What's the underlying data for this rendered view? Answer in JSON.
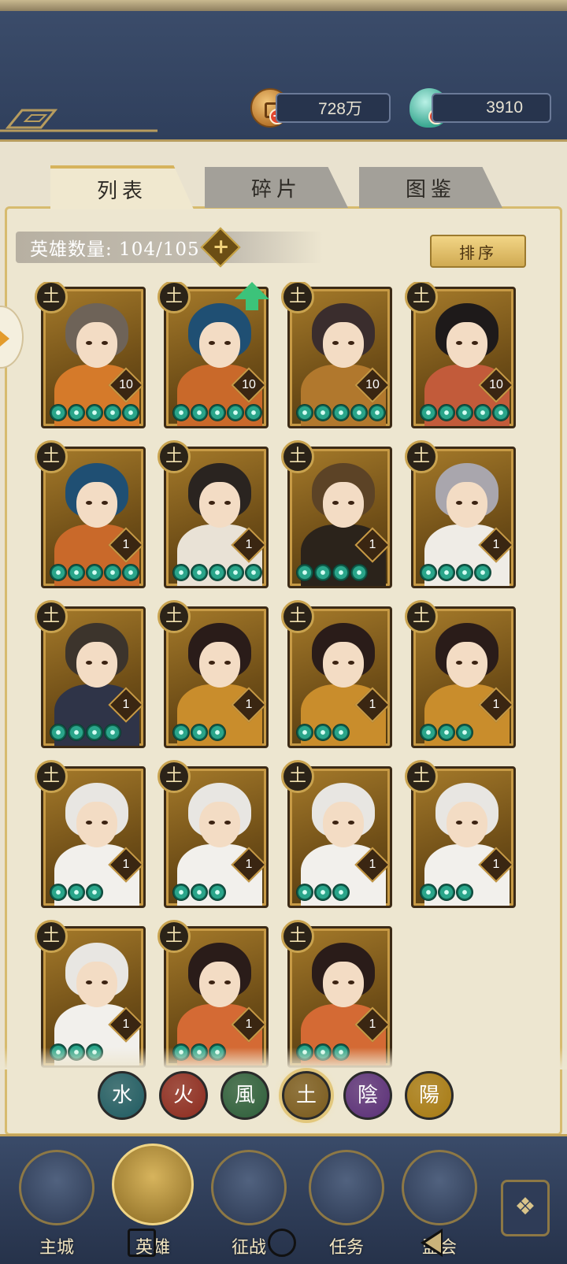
{
  "currency": {
    "coins": "728万",
    "jade": "3910"
  },
  "tabs": [
    "列表",
    "碎片",
    "图鉴"
  ],
  "hero_count": "英雄数量: 104/105",
  "sort_label": "排序",
  "element_symbol": "土",
  "heroes": [
    {
      "level": "10",
      "stars": 5,
      "hair": "#6e6358",
      "body": "#d57a2a",
      "upgrade": false
    },
    {
      "level": "10",
      "stars": 5,
      "hair": "#1f4f73",
      "body": "#c9692a",
      "upgrade": true
    },
    {
      "level": "10",
      "stars": 5,
      "hair": "#3a2d2d",
      "body": "#b1782d",
      "upgrade": false
    },
    {
      "level": "10",
      "stars": 5,
      "hair": "#1e1a1a",
      "body": "#c25b3a",
      "upgrade": false
    },
    {
      "level": "1",
      "stars": 5,
      "hair": "#1f4f73",
      "body": "#c9692a",
      "upgrade": false
    },
    {
      "level": "1",
      "stars": 5,
      "hair": "#2a2420",
      "body": "#e9e2d6",
      "upgrade": false
    },
    {
      "level": "1",
      "stars": 4,
      "hair": "#5c4326",
      "body": "#2b231b",
      "upgrade": false
    },
    {
      "level": "1",
      "stars": 4,
      "hair": "#a9a6ad",
      "body": "#efece6",
      "upgrade": false
    },
    {
      "level": "1",
      "stars": 4,
      "hair": "#3c342c",
      "body": "#2f3448",
      "upgrade": false
    },
    {
      "level": "1",
      "stars": 3,
      "hair": "#2a1c19",
      "body": "#c98d2c",
      "upgrade": false
    },
    {
      "level": "1",
      "stars": 3,
      "hair": "#2a1c19",
      "body": "#c98d2c",
      "upgrade": false
    },
    {
      "level": "1",
      "stars": 3,
      "hair": "#2a1c19",
      "body": "#c98d2c",
      "upgrade": false
    },
    {
      "level": "1",
      "stars": 3,
      "hair": "#e8e6e2",
      "body": "#f2f0ec",
      "upgrade": false
    },
    {
      "level": "1",
      "stars": 3,
      "hair": "#e8e6e2",
      "body": "#f2f0ec",
      "upgrade": false
    },
    {
      "level": "1",
      "stars": 3,
      "hair": "#e8e6e2",
      "body": "#f2f0ec",
      "upgrade": false
    },
    {
      "level": "1",
      "stars": 3,
      "hair": "#e8e6e2",
      "body": "#f2f0ec",
      "upgrade": false
    },
    {
      "level": "1",
      "stars": 3,
      "hair": "#e8e6e2",
      "body": "#f2f0ec",
      "upgrade": false
    },
    {
      "level": "1",
      "stars": 3,
      "hair": "#2a1c19",
      "body": "#d46a34",
      "upgrade": false
    },
    {
      "level": "1",
      "stars": 3,
      "hair": "#2a1c19",
      "body": "#d46a34",
      "upgrade": false
    }
  ],
  "filters": [
    {
      "symbol": "水",
      "color": "#1f5b62",
      "selected": false
    },
    {
      "symbol": "火",
      "color": "#8d2b1f",
      "selected": false
    },
    {
      "symbol": "風",
      "color": "#2d5e3a",
      "selected": false
    },
    {
      "symbol": "土",
      "color": "#7a5a1c",
      "selected": true
    },
    {
      "symbol": "陰",
      "color": "#5a2f78",
      "selected": false
    },
    {
      "symbol": "陽",
      "color": "#a77a12",
      "selected": false
    }
  ],
  "nav": [
    {
      "label": "主城"
    },
    {
      "label": "英雄",
      "active": true
    },
    {
      "label": "征战"
    },
    {
      "label": "任务"
    },
    {
      "label": "盟会"
    }
  ],
  "nav_extra_icon": "flower-pattern-icon"
}
